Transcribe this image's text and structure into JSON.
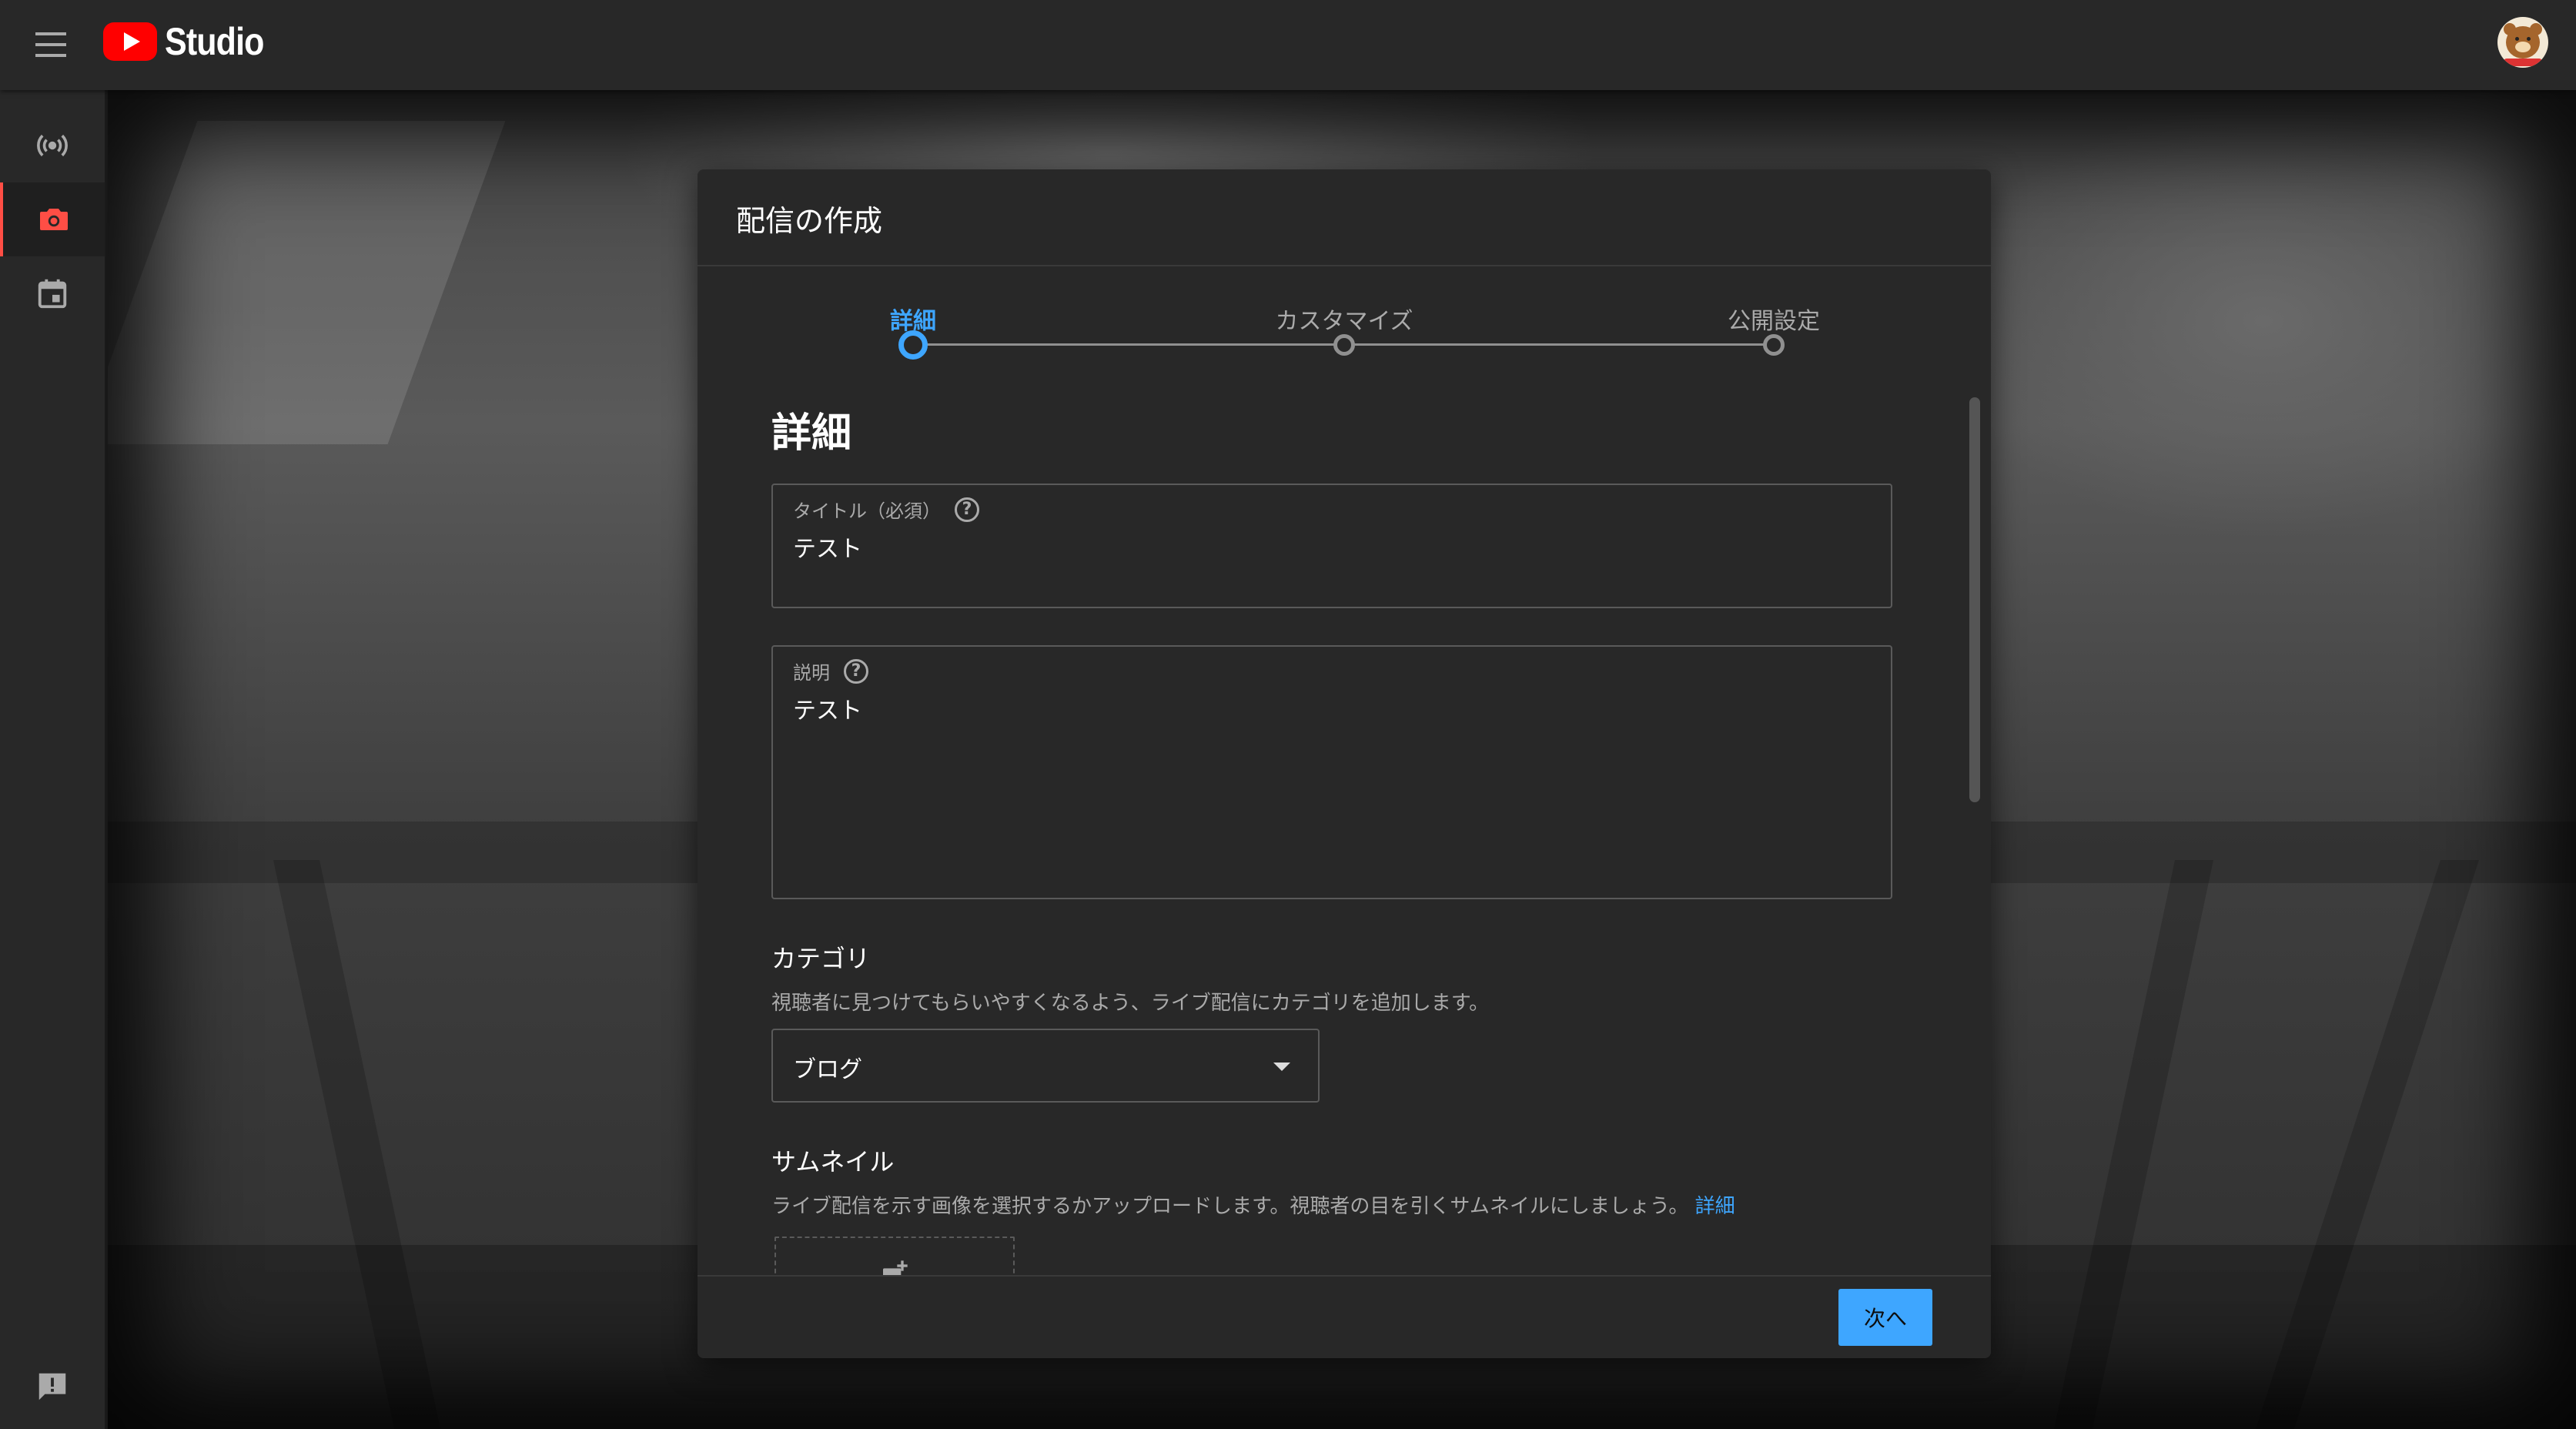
{
  "app": {
    "name": "Studio"
  },
  "sidebar": {
    "items": [
      {
        "icon": "live-broadcast-icon"
      },
      {
        "icon": "camera-icon",
        "active": true
      },
      {
        "icon": "calendar-icon"
      },
      {
        "icon": "feedback-icon"
      }
    ]
  },
  "dialog": {
    "title": "配信の作成",
    "steps": [
      {
        "label": "詳細",
        "active": true
      },
      {
        "label": "カスタマイズ",
        "active": false
      },
      {
        "label": "公開設定",
        "active": false
      }
    ],
    "section_title": "詳細",
    "title_field": {
      "label": "タイトル（必須）",
      "value": "テスト"
    },
    "description_field": {
      "label": "説明",
      "value": "テスト"
    },
    "category": {
      "title": "カテゴリ",
      "description": "視聴者に見つけてもらいやすくなるよう、ライブ配信にカテゴリを追加します。",
      "selected": "ブログ"
    },
    "thumbnail": {
      "title": "サムネイル",
      "description": "ライブ配信を示す画像を選択するかアップロードします。視聴者の目を引くサムネイルにしましょう。",
      "link": "詳細"
    },
    "next_button": "次へ"
  },
  "colors": {
    "accent": "#3ea6ff",
    "brand": "#ff0000",
    "active_nav": "#ff4e45"
  }
}
